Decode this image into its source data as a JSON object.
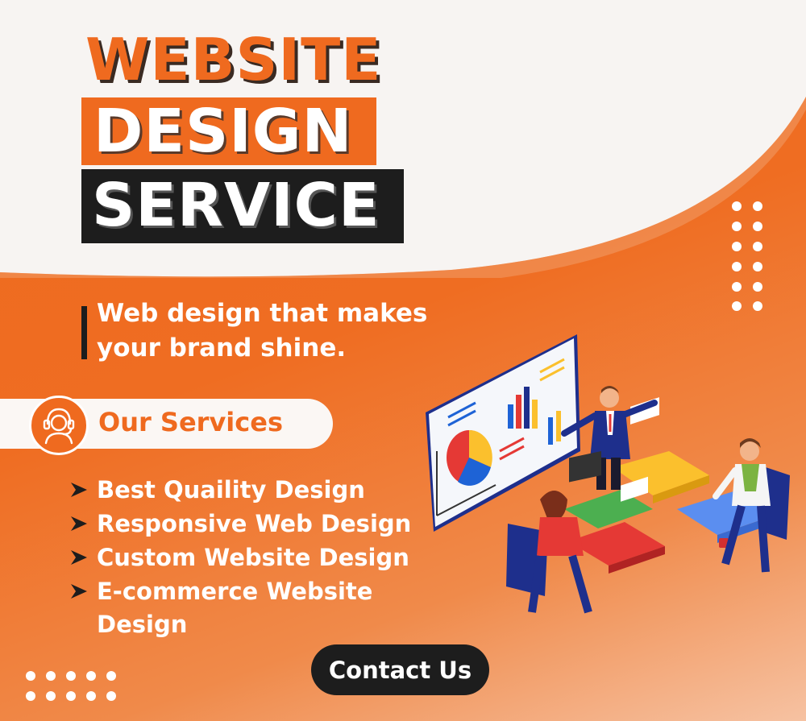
{
  "title": {
    "line1": "WEBSITE",
    "line2": "DESIGN",
    "line3": "SERVICE"
  },
  "tagline": {
    "line1": "Web design that makes",
    "line2": "your brand shine."
  },
  "services": {
    "heading": "Our Services",
    "icon": "customer-support-icon",
    "items": [
      "Best Quaility Design",
      "Responsive Web Design",
      "Custom Website Design",
      "E-commerce Website Design"
    ]
  },
  "cta": {
    "label": "Contact Us"
  },
  "colors": {
    "brand_orange": "#ef6a1f",
    "dark": "#1d1d1d",
    "white": "#ffffff"
  }
}
